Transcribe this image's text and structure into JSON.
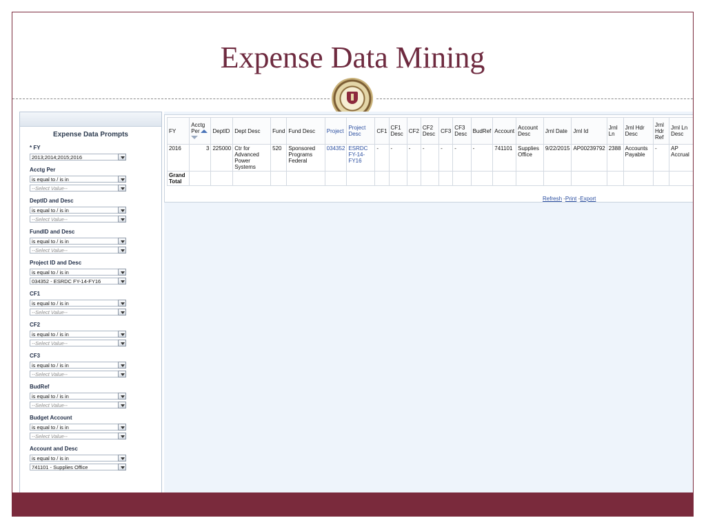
{
  "slide": {
    "title": "Expense Data Mining"
  },
  "prompts": {
    "title": "Expense Data Prompts",
    "groups": [
      {
        "label": "* FY",
        "fields": [
          {
            "value": "2013;2014;2015;2016",
            "placeholder": false
          }
        ]
      },
      {
        "label": "Acctg Per",
        "fields": [
          {
            "value": "is equal to / is in",
            "placeholder": false
          },
          {
            "value": "--Select Value--",
            "placeholder": true
          }
        ]
      },
      {
        "label": "DeptID and Desc",
        "fields": [
          {
            "value": "is equal to / is in",
            "placeholder": false
          },
          {
            "value": "--Select Value--",
            "placeholder": true
          }
        ]
      },
      {
        "label": "FundID and Desc",
        "fields": [
          {
            "value": "is equal to / is in",
            "placeholder": false
          },
          {
            "value": "--Select Value--",
            "placeholder": true
          }
        ]
      },
      {
        "label": "Project ID and Desc",
        "fields": [
          {
            "value": "is equal to / is in",
            "placeholder": false
          },
          {
            "value": "034352 - ESRDC FY-14-FY16",
            "placeholder": false
          }
        ]
      },
      {
        "label": "CF1",
        "fields": [
          {
            "value": "is equal to / is in",
            "placeholder": false
          },
          {
            "value": "--Select Value--",
            "placeholder": true
          }
        ]
      },
      {
        "label": "CF2",
        "fields": [
          {
            "value": "is equal to / is in",
            "placeholder": false
          },
          {
            "value": "--Select Value--",
            "placeholder": true
          }
        ]
      },
      {
        "label": "CF3",
        "fields": [
          {
            "value": "is equal to / is in",
            "placeholder": false
          },
          {
            "value": "--Select Value--",
            "placeholder": true
          }
        ]
      },
      {
        "label": "BudRef",
        "fields": [
          {
            "value": "is equal to / is in",
            "placeholder": false
          },
          {
            "value": "--Select Value--",
            "placeholder": true
          }
        ]
      },
      {
        "label": "Budget Account",
        "fields": [
          {
            "value": "is equal to / is in",
            "placeholder": false
          },
          {
            "value": "--Select Value--",
            "placeholder": true
          }
        ]
      },
      {
        "label": "Account and Desc",
        "fields": [
          {
            "value": "is equal to / is in",
            "placeholder": false
          },
          {
            "value": "741101 - Supplies Office",
            "placeholder": false
          }
        ]
      }
    ]
  },
  "results": {
    "columns": [
      {
        "label": "FY"
      },
      {
        "label": "Acctg Per",
        "sort": true
      },
      {
        "label": "DeptID"
      },
      {
        "label": "Dept Desc"
      },
      {
        "label": "Fund"
      },
      {
        "label": "Fund Desc"
      },
      {
        "label": "Project",
        "link": true
      },
      {
        "label": "Project Desc",
        "link": true
      },
      {
        "label": "CF1"
      },
      {
        "label": "CF1 Desc"
      },
      {
        "label": "CF2"
      },
      {
        "label": "CF2 Desc"
      },
      {
        "label": "CF3"
      },
      {
        "label": "CF3 Desc"
      },
      {
        "label": "BudRef"
      },
      {
        "label": "Account"
      },
      {
        "label": "Account Desc"
      },
      {
        "label": "Jrnl Date"
      },
      {
        "label": "Jrnl Id"
      },
      {
        "label": "Jrnl Ln"
      },
      {
        "label": "Jrnl Hdr Desc"
      },
      {
        "label": "Jrnl Hdr Ref"
      },
      {
        "label": "Jrnl Ln Desc"
      }
    ],
    "rows": [
      [
        "2016",
        "3",
        "225000",
        "Ctr for Advanced Power Systems",
        "520",
        "Sponsored Programs Federal",
        "034352",
        "ESRDC FY-14-FY16",
        "-",
        "-",
        "-",
        "-",
        "-",
        "-",
        "-",
        "741101",
        "Supplies Office",
        "9/22/2015",
        "AP00239792",
        "2388",
        "Accounts Payable",
        "-",
        "AP Accrual"
      ]
    ],
    "grand_total_label": "Grand Total",
    "links": {
      "refresh": "Refresh",
      "print": "Print",
      "export": "Export"
    }
  },
  "colors": {
    "brand": "#7a2a3c",
    "title": "#6e2a3f",
    "link": "#2a4ea0"
  }
}
